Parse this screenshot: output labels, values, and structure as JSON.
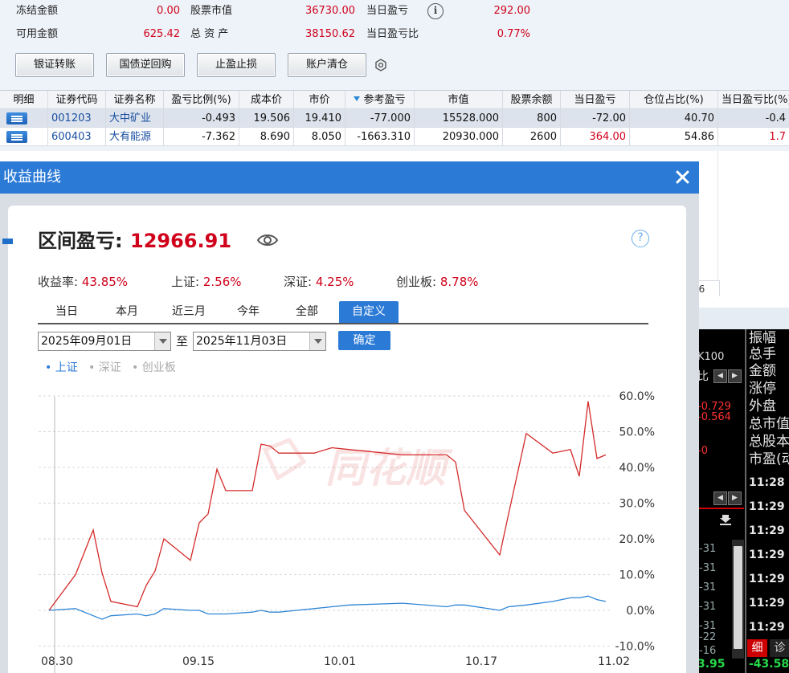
{
  "summary": {
    "frozen_label": "冻结金额",
    "frozen_value": "0.00",
    "stock_mv_label": "股票市值",
    "stock_mv_value": "36730.00",
    "day_pnl_label": "当日盈亏",
    "day_pnl_value": "292.00",
    "available_label": "可用金额",
    "available_value": "625.42",
    "total_assets_label": "总 资 产",
    "total_assets_value": "38150.62",
    "day_pnl_ratio_label": "当日盈亏比",
    "day_pnl_ratio_value": "0.77%",
    "info_glyph": "i"
  },
  "toolbar": {
    "bank_transfer": "银证转账",
    "repo": "国债逆回购",
    "stop": "止盈止损",
    "clear": "账户清仓"
  },
  "table": {
    "headers": [
      "明细",
      "证券代码",
      "证券名称",
      "盈亏比例(%)",
      "成本价",
      "市价",
      "参考盈亏",
      "市值",
      "股票余额",
      "当日盈亏",
      "仓位占比(%)",
      "当日盈亏比(%)"
    ],
    "rows": [
      {
        "code": "001203",
        "name": "大中矿业",
        "pnl_ratio": "-0.493",
        "cost": "19.506",
        "price": "19.410",
        "ref_pnl": "-77.000",
        "mv": "15528.000",
        "balance": "800",
        "day_pnl": "-72.00",
        "position": "40.70",
        "day_ratio": "-0.4"
      },
      {
        "code": "600403",
        "name": "大有能源",
        "pnl_ratio": "-7.362",
        "cost": "8.690",
        "price": "8.050",
        "ref_pnl": "-1663.310",
        "mv": "20930.000",
        "balance": "2600",
        "day_pnl": "364.00",
        "position": "54.86",
        "day_ratio": "1.7"
      }
    ],
    "footer_fragment": "56"
  },
  "market": {
    "labels": [
      "振幅",
      "总手",
      "金额",
      "涨停",
      "外盘",
      "总市值",
      "总股本",
      "市盈(动"
    ],
    "code_fragment": "K100",
    "ratio_fragment": "比",
    "prices": [
      "-0.729",
      "-0.564",
      "-0"
    ],
    "times": [
      "11:28",
      "11:29",
      "11:29",
      "11:29",
      "11:29",
      "11:29",
      "11:29"
    ],
    "small": [
      "-31",
      "-31",
      "-31",
      "-31",
      "-31",
      "-22",
      "-16"
    ],
    "bottom_left": "3.95",
    "bottom_right": "-43.58",
    "tab1": "细",
    "tab2": "诊"
  },
  "dialog": {
    "title": "收益曲线",
    "pnl_label": "区间盈亏:",
    "pnl_value": "12966.91",
    "help_glyph": "?",
    "stats": [
      {
        "label": "收益率:",
        "value": "43.85%"
      },
      {
        "label": "上证:",
        "value": "2.56%"
      },
      {
        "label": "深证:",
        "value": "4.25%"
      },
      {
        "label": "创业板:",
        "value": "8.78%"
      }
    ],
    "tabs": [
      "当日",
      "本月",
      "近三月",
      "今年",
      "全部",
      "自定义"
    ],
    "start_date": "2025年09月01日",
    "to_label": "至",
    "end_date": "2025年11月03日",
    "confirm": "确定",
    "legend": [
      "上证",
      "深证",
      "创业板"
    ],
    "watermark": "同花顺"
  },
  "chart_data": {
    "type": "line",
    "x_ticks": [
      "08.30",
      "09.15",
      "10.01",
      "10.17",
      "11.02"
    ],
    "y_ticks": [
      "60.0%",
      "50.0%",
      "40.0%",
      "30.0%",
      "20.0%",
      "10.0%",
      "0.0%",
      "-10.0%"
    ],
    "ylim": [
      -10,
      60
    ],
    "colors": {
      "profit": "#d42a2a",
      "index": "#2f86d6"
    },
    "series": [
      {
        "x": [
          0,
          3,
          5,
          6,
          7,
          10,
          11,
          12,
          13,
          16,
          17,
          18,
          19,
          20,
          23,
          24,
          25,
          26,
          28,
          30,
          32,
          34,
          40,
          45,
          46,
          47,
          51,
          52,
          54,
          57,
          58,
          59,
          60,
          61,
          62,
          63
        ],
        "values": [
          0,
          10,
          22.5,
          10.5,
          2.5,
          1,
          7,
          11,
          20,
          14,
          24.5,
          27,
          39.5,
          33.5,
          33.5,
          46.5,
          46,
          44,
          44,
          44,
          45.5,
          45,
          43.5,
          43.5,
          41.5,
          28,
          15.5,
          27,
          49.5,
          44,
          44.5,
          45,
          37.5,
          58.5,
          42.5,
          43.5
        ]
      },
      {
        "x": [
          0,
          3,
          5,
          6,
          7,
          10,
          11,
          12,
          13,
          16,
          17,
          18,
          19,
          20,
          23,
          24,
          25,
          26,
          28,
          30,
          32,
          34,
          40,
          45,
          46,
          47,
          51,
          52,
          54,
          57,
          58,
          59,
          60,
          61,
          62,
          63
        ],
        "values": [
          0,
          0.5,
          -1.5,
          -2.5,
          -1.5,
          -1,
          -1.5,
          -1,
          0.5,
          0,
          0,
          -1,
          -1,
          -1,
          -0.5,
          0,
          -0.5,
          -0.5,
          0,
          0.5,
          1,
          1.5,
          2,
          1,
          1.5,
          1.5,
          0,
          1,
          1.5,
          2.5,
          3,
          3.5,
          3.5,
          4,
          3,
          2.5
        ]
      }
    ]
  }
}
